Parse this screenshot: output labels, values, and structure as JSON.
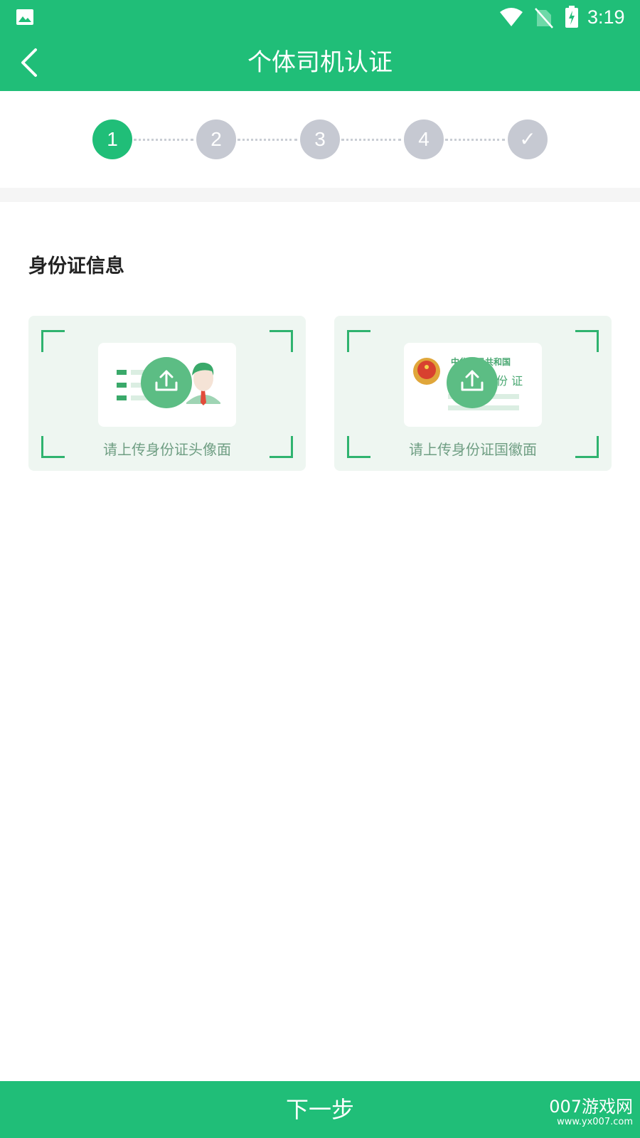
{
  "status_bar": {
    "time": "3:19",
    "icons": [
      "image-icon",
      "wifi-icon",
      "no-sim-icon",
      "battery-charging-icon"
    ]
  },
  "header": {
    "title": "个体司机认证",
    "back_icon": "chevron-left-icon"
  },
  "stepper": {
    "steps": [
      "1",
      "2",
      "3",
      "4",
      "✓"
    ],
    "active_index": 0
  },
  "section": {
    "title": "身份证信息"
  },
  "upload_cards": [
    {
      "caption": "请上传身份证头像面",
      "icon": "upload-icon"
    },
    {
      "caption": "请上传身份证国徽面",
      "icon": "upload-icon",
      "card_text_1": "中华人民共和国",
      "card_text_2": "份 证"
    }
  ],
  "footer": {
    "next_label": "下一步"
  },
  "watermark": {
    "main": "007游戏网",
    "sub": "www.yx007.com"
  },
  "colors": {
    "brand_green": "#20be78",
    "inactive_step": "#c6c9d2",
    "card_bg": "#eef6f1"
  }
}
